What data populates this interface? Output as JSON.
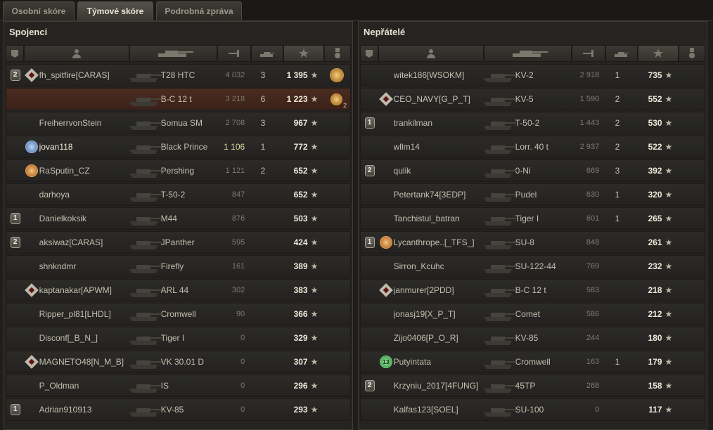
{
  "tabs": [
    "Osobní skóre",
    "Týmové skóre",
    "Podrobná zpráva"
  ],
  "active_tab": 1,
  "left": {
    "title": "Spojenci",
    "rows": [
      {
        "plat": "2",
        "icon": "clan",
        "name": "fh_spitfire[CARAS]",
        "tank": "T28 HTC",
        "dmg": "4 032",
        "kills": "3",
        "xp": "1 395",
        "medal": "medal"
      },
      {
        "plat": "",
        "icon": "",
        "name": "",
        "tank": "B-C 12 t",
        "dmg": "3 218",
        "kills": "6",
        "xp": "1 223",
        "medal": "medal2",
        "hl": true
      },
      {
        "plat": "",
        "icon": "",
        "name": "FreiherrvonStein",
        "tank": "Somua SM",
        "dmg": "2 708",
        "kills": "3",
        "xp": "967",
        "medal": ""
      },
      {
        "plat": "",
        "icon": "ach-blue",
        "name": "jovan118",
        "tank": "Black Prince",
        "dmg": "1 106",
        "kills": "1",
        "xp": "772",
        "medal": "",
        "me": true
      },
      {
        "plat": "",
        "icon": "ach",
        "name": "RaSputin_CZ",
        "tank": "Pershing",
        "dmg": "1 121",
        "kills": "2",
        "xp": "652",
        "medal": ""
      },
      {
        "plat": "",
        "icon": "",
        "name": "darhoya",
        "tank": "T-50-2",
        "dmg": "847",
        "kills": "",
        "xp": "652",
        "medal": ""
      },
      {
        "plat": "1",
        "icon": "",
        "name": "Danielkoksik",
        "tank": "M44",
        "dmg": "876",
        "kills": "",
        "xp": "503",
        "medal": ""
      },
      {
        "plat": "2",
        "icon": "",
        "name": "aksiwaz[CARAS]",
        "tank": "JPanther",
        "dmg": "595",
        "kills": "",
        "xp": "424",
        "medal": ""
      },
      {
        "plat": "",
        "icon": "",
        "name": "shnkndmr",
        "tank": "Firefly",
        "dmg": "161",
        "kills": "",
        "xp": "389",
        "medal": ""
      },
      {
        "plat": "",
        "icon": "clan",
        "name": "kaptanakar[APWM]",
        "tank": "ARL 44",
        "dmg": "302",
        "kills": "",
        "xp": "383",
        "medal": ""
      },
      {
        "plat": "",
        "icon": "",
        "name": "Ripper_pl81[LHDL]",
        "tank": "Cromwell",
        "dmg": "90",
        "kills": "",
        "xp": "366",
        "medal": ""
      },
      {
        "plat": "",
        "icon": "",
        "name": "Disconf[_B_N_]",
        "tank": "Tiger I",
        "dmg": "0",
        "kills": "",
        "xp": "329",
        "medal": ""
      },
      {
        "plat": "",
        "icon": "clan",
        "name": "MAGNETO48[N_M_B]",
        "tank": "VK 30.01 D",
        "dmg": "0",
        "kills": "",
        "xp": "307",
        "medal": ""
      },
      {
        "plat": "",
        "icon": "",
        "name": "P_Oldman",
        "tank": "IS",
        "dmg": "0",
        "kills": "",
        "xp": "296",
        "medal": ""
      },
      {
        "plat": "1",
        "icon": "",
        "name": "Adrian910913",
        "tank": "KV-85",
        "dmg": "0",
        "kills": "",
        "xp": "293",
        "medal": ""
      }
    ]
  },
  "right": {
    "title": "Nepřátelé",
    "rows": [
      {
        "plat": "",
        "icon": "",
        "name": "witek186[WSOKM]",
        "tank": "KV-2",
        "dmg": "2 918",
        "kills": "1",
        "xp": "735",
        "medal": ""
      },
      {
        "plat": "",
        "icon": "clan",
        "name": "CEO_NAVY[G_P_T]",
        "tank": "KV-5",
        "dmg": "1 590",
        "kills": "2",
        "xp": "552",
        "medal": ""
      },
      {
        "plat": "1",
        "icon": "",
        "name": "trankilman",
        "tank": "T-50-2",
        "dmg": "1 443",
        "kills": "2",
        "xp": "530",
        "medal": ""
      },
      {
        "plat": "",
        "icon": "",
        "name": "wllm14",
        "tank": "Lorr. 40 t",
        "dmg": "2 937",
        "kills": "2",
        "xp": "522",
        "medal": ""
      },
      {
        "plat": "2",
        "icon": "",
        "name": "qulik",
        "tank": "0-Ni",
        "dmg": "669",
        "kills": "3",
        "xp": "392",
        "medal": ""
      },
      {
        "plat": "",
        "icon": "",
        "name": "Petertank74[3EDP]",
        "tank": "Pudel",
        "dmg": "630",
        "kills": "1",
        "xp": "320",
        "medal": ""
      },
      {
        "plat": "",
        "icon": "",
        "name": "Tanchistul_batran",
        "tank": "Tiger I",
        "dmg": "601",
        "kills": "1",
        "xp": "265",
        "medal": ""
      },
      {
        "plat": "1",
        "icon": "ach",
        "name": "Lycanthrope..[_TFS_]",
        "tank": "SU-8",
        "dmg": "848",
        "kills": "",
        "xp": "261",
        "medal": ""
      },
      {
        "plat": "",
        "icon": "",
        "name": "Sirron_Kcuhc",
        "tank": "SU-122-44",
        "dmg": "769",
        "kills": "",
        "xp": "232",
        "medal": ""
      },
      {
        "plat": "",
        "icon": "clan",
        "name": "janmurer[2PDD]",
        "tank": "B-C 12 t",
        "dmg": "583",
        "kills": "",
        "xp": "218",
        "medal": ""
      },
      {
        "plat": "",
        "icon": "",
        "name": "jonasj19[X_P_T]",
        "tank": "Comet",
        "dmg": "586",
        "kills": "",
        "xp": "212",
        "medal": ""
      },
      {
        "plat": "",
        "icon": "",
        "name": "Zijo0406[P_O_R]",
        "tank": "KV-85",
        "dmg": "244",
        "kills": "",
        "xp": "180",
        "medal": ""
      },
      {
        "plat": "",
        "icon": "ach-green",
        "name": "Putyintata",
        "tank": "Cromwell",
        "dmg": "163",
        "kills": "1",
        "xp": "179",
        "medal": ""
      },
      {
        "plat": "2",
        "icon": "",
        "name": "Krzyniu_2017[4FUNG]",
        "tank": "45TP",
        "dmg": "268",
        "kills": "",
        "xp": "158",
        "medal": ""
      },
      {
        "plat": "",
        "icon": "",
        "name": "Kalfas123[SOEL]",
        "tank": "SU-100",
        "dmg": "0",
        "kills": "",
        "xp": "117",
        "medal": ""
      }
    ]
  },
  "ach_green_label": "13",
  "medal2_count": "2",
  "star_glyph": "★",
  "header_icons": [
    "platoon-icon",
    "player-icon",
    "tank-icon",
    "damage-icon",
    "kills-icon",
    "xp-icon",
    "medal-icon"
  ],
  "colors": {
    "highlight_row": "#4a2c20",
    "xp_text": "#ece7d9"
  }
}
